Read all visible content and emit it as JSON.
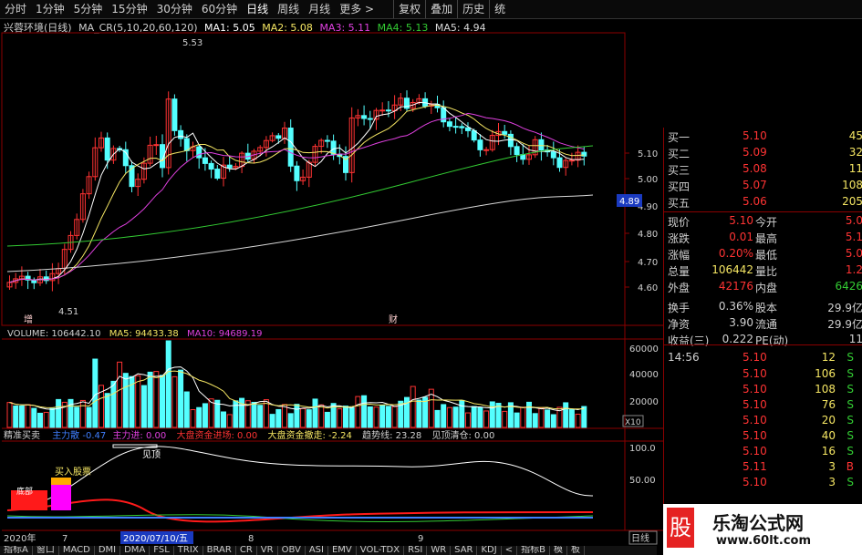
{
  "toolbar": {
    "tabs": [
      "分时",
      "1分钟",
      "5分钟",
      "15分钟",
      "30分钟",
      "60分钟",
      "日线",
      "周线",
      "月线",
      "更多 >"
    ],
    "right_tabs": [
      "复权",
      "叠加",
      "历史",
      "统"
    ]
  },
  "chart_header": {
    "name": "兴蓉环境(日线)",
    "ma_label": "MA_CR(5,10,20,60,120)",
    "ma1": "MA1: 5.05",
    "ma2": "MA2: 5.08",
    "ma3": "MA3: 5.11",
    "ma4": "MA4: 5.13",
    "ma5": "MA5: 4.94"
  },
  "price_chart": {
    "y_ticks": [
      "5.10",
      "5.00",
      "4.90",
      "4.80",
      "4.70",
      "4.60"
    ],
    "high_label": "5.53",
    "low_label": "4.51",
    "current_price_tag": "4.89",
    "marker_left": "增",
    "marker_mid": "财"
  },
  "volume_header": {
    "volume": "VOLUME: 106442.10",
    "ma5": "MA5: 94433.38",
    "ma10": "MA10: 94689.19"
  },
  "volume_chart": {
    "y_ticks": [
      "60000",
      "40000",
      "20000"
    ],
    "unit": "X10"
  },
  "indicator_header": {
    "name": "精准买卖",
    "i1": "主力散",
    "i1_val": "-0.47",
    "i2": "主力进:",
    "i2_val": "0.00",
    "i3": "大盘资金进场:",
    "i3_val": "0.00",
    "i4": "大盘资金撤走:",
    "i4_val": "-2.24",
    "i5": "趋势线:",
    "i5_val": "23.28",
    "i6": "见顶清仓:",
    "i6_val": "0.00"
  },
  "indicator_chart": {
    "y_ticks": [
      "100.0",
      "50.00"
    ],
    "buy_label": "买入股票",
    "top_label": "见顶",
    "bottom_label": "底部"
  },
  "date_axis": {
    "year": "2020年",
    "m7": "7",
    "date_cursor": "2020/07/10/五",
    "m8": "8",
    "m9": "9"
  },
  "order_book": {
    "rows": [
      {
        "label": "买一",
        "price": "5.10",
        "vol": "45"
      },
      {
        "label": "买二",
        "price": "5.09",
        "vol": "32"
      },
      {
        "label": "买三",
        "price": "5.08",
        "vol": "11"
      },
      {
        "label": "买四",
        "price": "5.07",
        "vol": "108"
      },
      {
        "label": "买五",
        "price": "5.06",
        "vol": "205"
      }
    ]
  },
  "stats": {
    "rows": [
      {
        "l1": "现价",
        "v1": "5.10",
        "l2": "今开",
        "v2": "5.0"
      },
      {
        "l1": "涨跌",
        "v1": "0.01",
        "l2": "最高",
        "v2": "5.1"
      },
      {
        "l1": "涨幅",
        "v1": "0.20%",
        "l2": "最低",
        "v2": "5.0"
      },
      {
        "l1": "总量",
        "v1": "106442",
        "l2": "量比",
        "v2": "1.2"
      },
      {
        "l1": "外盘",
        "v1": "42176",
        "l2": "内盘",
        "v2": "6426"
      },
      {
        "l1": "换手",
        "v1": "0.36%",
        "l2": "股本",
        "v2": "29.9亿"
      },
      {
        "l1": "净资",
        "v1": "3.90",
        "l2": "流通",
        "v2": "29.9亿"
      },
      {
        "l1": "收益(三)",
        "v1": "0.222",
        "l2": "PE(动)",
        "v2": "11"
      }
    ]
  },
  "ticks": {
    "time": "14:56",
    "rows": [
      {
        "price": "5.10",
        "vol": "12",
        "side": "S"
      },
      {
        "price": "5.10",
        "vol": "106",
        "side": "S"
      },
      {
        "price": "5.10",
        "vol": "108",
        "side": "S"
      },
      {
        "price": "5.10",
        "vol": "76",
        "side": "S"
      },
      {
        "price": "5.10",
        "vol": "20",
        "side": "S"
      },
      {
        "price": "5.10",
        "vol": "40",
        "side": "S"
      },
      {
        "price": "5.10",
        "vol": "16",
        "side": "S"
      },
      {
        "price": "5.11",
        "vol": "3",
        "side": "B"
      },
      {
        "price": "5.10",
        "vol": "3",
        "side": "S"
      }
    ]
  },
  "right_side": {
    "day_btn": "日线"
  },
  "bottom_tabs": [
    "指标A",
    "窗口",
    "MACD",
    "DMI",
    "DMA",
    "FSL",
    "TRIX",
    "BRAR",
    "CR",
    "VR",
    "OBV",
    "ASI",
    "EMV",
    "VOL-TDX",
    "RSI",
    "WR",
    "SAR",
    "KDJ",
    "<",
    "指标B",
    "模",
    "板"
  ],
  "watermark": {
    "char": "股",
    "name": "乐淘公式网",
    "url": "www.60lt.com"
  },
  "colors": {
    "up": "#ff3333",
    "down": "#54ffff",
    "ma1": "#ffffff",
    "ma2": "#f5e663",
    "ma3": "#e040e0",
    "ma4": "#33cc33",
    "ma5": "#d8d8d8"
  }
}
